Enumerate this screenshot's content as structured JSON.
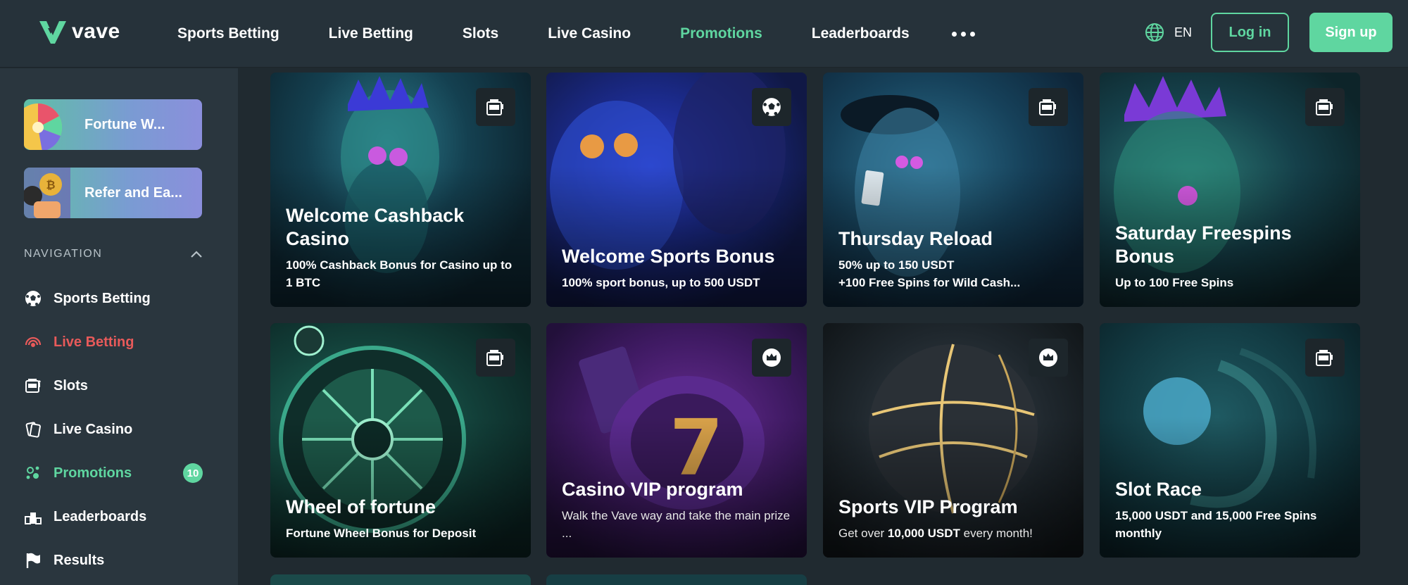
{
  "brand": {
    "name": "vave",
    "accent": "#5fd6a0",
    "live_color": "#e85a5a"
  },
  "header": {
    "nav": [
      {
        "label": "Sports Betting",
        "active": false
      },
      {
        "label": "Live Betting",
        "active": false
      },
      {
        "label": "Slots",
        "active": false
      },
      {
        "label": "Live Casino",
        "active": false
      },
      {
        "label": "Promotions",
        "active": true
      },
      {
        "label": "Leaderboards",
        "active": false
      }
    ],
    "more_icon": "ellipsis-icon",
    "language": "EN",
    "login_label": "Log in",
    "signup_label": "Sign up"
  },
  "sidebar": {
    "promos": [
      {
        "label": "Fortune W...",
        "icon": "fortune-wheel-image"
      },
      {
        "label": "Refer and Ea...",
        "icon": "refer-coins-image"
      }
    ],
    "nav_heading": "NAVIGATION",
    "items": [
      {
        "label": "Sports Betting",
        "icon": "soccer-ball-icon"
      },
      {
        "label": "Live Betting",
        "icon": "live-broadcast-icon"
      },
      {
        "label": "Slots",
        "icon": "slot-machine-icon"
      },
      {
        "label": "Live Casino",
        "icon": "cards-icon"
      },
      {
        "label": "Promotions",
        "icon": "gift-icon",
        "badge": "10"
      },
      {
        "label": "Leaderboards",
        "icon": "podium-icon"
      },
      {
        "label": "Results",
        "icon": "flag-icon"
      }
    ]
  },
  "promotions": [
    {
      "title": "Welcome Cashback Casino",
      "subtitle": "100% Cashback Bonus for Casino up to 1 BTC",
      "tag_icon": "slot-machine-icon"
    },
    {
      "title": "Welcome Sports Bonus",
      "subtitle": "100% sport bonus, up to 500 USDT",
      "tag_icon": "soccer-ball-icon"
    },
    {
      "title": "Thursday Reload",
      "subtitle_line1": "50% up to 150 USDT",
      "subtitle_line2": "+100 Free Spins for Wild Cash...",
      "tag_icon": "slot-machine-icon"
    },
    {
      "title": "Saturday Freespins Bonus",
      "subtitle": "Up to 100 Free Spins",
      "tag_icon": "slot-machine-icon"
    },
    {
      "title": "Wheel of fortune",
      "subtitle": "Fortune Wheel Bonus for Deposit",
      "tag_icon": "slot-machine-icon"
    },
    {
      "title": "Casino VIP program",
      "subtitle": "Walk the Vave way and take the main prize ...",
      "tag_icon": "crown-icon"
    },
    {
      "title": "Sports VIP Program",
      "subtitle_pre": "Get over ",
      "subtitle_bold": "10,000 USDT",
      "subtitle_post": " every month!",
      "tag_icon": "crown-icon"
    },
    {
      "title": "Slot Race",
      "subtitle": "15,000 USDT and 15,000 Free Spins monthly",
      "tag_icon": "slot-machine-icon"
    }
  ]
}
